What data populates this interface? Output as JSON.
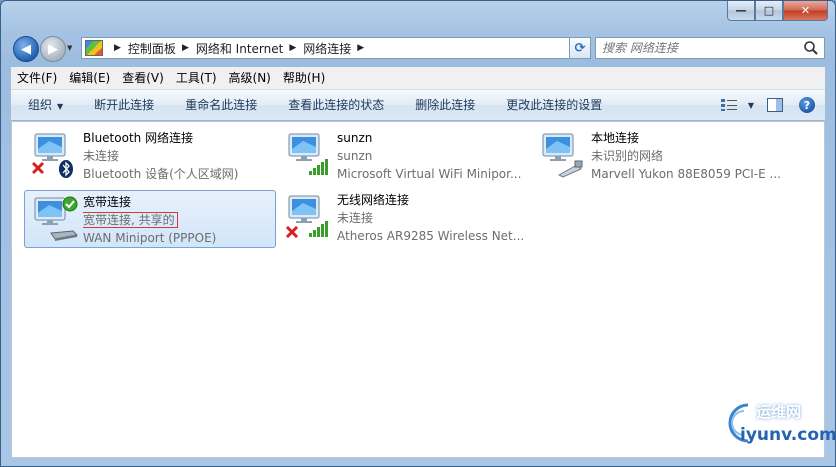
{
  "window": {
    "caption": {
      "minimize": "—",
      "maximize": "□",
      "close": "✕"
    }
  },
  "nav": {
    "back_icon": "back-arrow-icon",
    "forward_icon": "forward-arrow-icon",
    "breadcrumb": [
      "控制面板",
      "网络和 Internet",
      "网络连接"
    ],
    "search_placeholder": "搜索 网络连接"
  },
  "menu": {
    "items": [
      "文件(F)",
      "编辑(E)",
      "查看(V)",
      "工具(T)",
      "高级(N)",
      "帮助(H)"
    ]
  },
  "toolbar": {
    "organize": "组织",
    "commands": [
      "断开此连接",
      "重命名此连接",
      "查看此连接的状态",
      "删除此连接",
      "更改此连接的设置"
    ]
  },
  "connections": [
    {
      "name": "Bluetooth 网络连接",
      "status": "未连接",
      "device": "Bluetooth 设备(个人区域网)",
      "badge": "red-x-icon",
      "kind": "bluetooth-icon"
    },
    {
      "name": "sunzn",
      "status": "sunzn",
      "device": "Microsoft Virtual WiFi Minipor...",
      "badge": "",
      "kind": "signal-bars-icon"
    },
    {
      "name": "本地连接",
      "status": "未识别的网络",
      "device": "Marvell Yukon 88E8059 PCI-E ...",
      "badge": "",
      "kind": "ethernet-plug-icon"
    },
    {
      "name": "宽带连接",
      "status": "宽带连接, 共享的",
      "device": "WAN Miniport (PPPOE)",
      "badge": "green-check-icon",
      "kind": "modem-icon",
      "selected": true
    },
    {
      "name": "无线网络连接",
      "status": "未连接",
      "device": "Atheros AR9285 Wireless Net...",
      "badge": "red-x-icon",
      "kind": "signal-bars-icon"
    }
  ],
  "watermark": {
    "top": "运维网",
    "bottom": "iyunv.com"
  },
  "colors": {
    "selected_bg": "#d2e5fa",
    "selected_border": "#7da2ce",
    "highlight_box": "#d43a3a",
    "signal_green": "#3c9e2a"
  }
}
